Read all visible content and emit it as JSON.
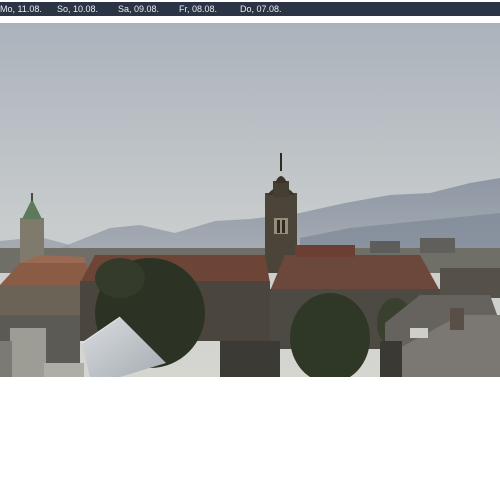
{
  "date_tabs": [
    {
      "label": "Mo, 11.08."
    },
    {
      "label": "So, 10.08."
    },
    {
      "label": "Sa, 09.08."
    },
    {
      "label": "Fr, 08.08."
    },
    {
      "label": "Do, 07.08."
    }
  ],
  "colors": {
    "bar_bg": "#2b3444",
    "bar_text": "#e9edf3",
    "sky_top": "#aeb5bd",
    "sky_bottom": "#d3d5d2"
  },
  "image": {
    "subject": "webcam-city-view"
  }
}
